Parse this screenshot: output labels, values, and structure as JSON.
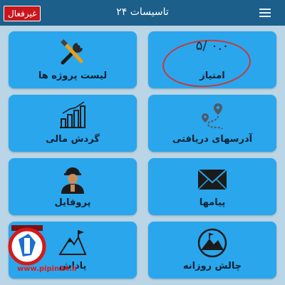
{
  "app": {
    "title": "تاسیسات ۲۴",
    "status_badge": "غیرفعال"
  },
  "tiles": {
    "projects": {
      "label": "لیست پروژه ها",
      "icon": "tools-icon"
    },
    "score": {
      "label": "امتیاز",
      "value_text": "۵/ ۰.۰"
    },
    "finance": {
      "label": "گردش مالی",
      "icon": "bar-chart-icon"
    },
    "addresses": {
      "label": "آدرسهای دریافتی",
      "icon": "route-pin-icon"
    },
    "profile": {
      "label": "پروفایل",
      "icon": "worker-avatar-icon"
    },
    "messages": {
      "label": "پیامها",
      "icon": "envelope-icon"
    },
    "rewards": {
      "label": "پاداش",
      "icon": "mountain-flag-icon"
    },
    "daily_challenge": {
      "label": "چالش روزانه",
      "icon": "mountain-badge-icon"
    }
  },
  "watermark": {
    "url": "www.pipin24.ir"
  },
  "colors": {
    "app_bar": "#1c5f8a",
    "tile": "#2aa6ec",
    "badge": "#c8161d",
    "annotation": "#c43a3a"
  }
}
